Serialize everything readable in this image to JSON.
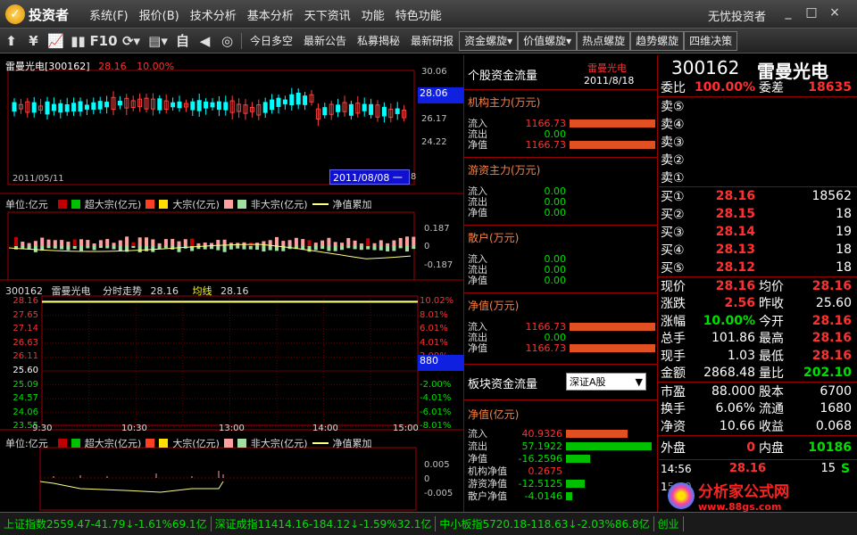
{
  "app": {
    "logo_text": "投资者",
    "brand": "无忧投资者"
  },
  "menu": [
    "系统(F)",
    "报价(B)",
    "技术分析",
    "基本分析",
    "天下资讯",
    "功能",
    "特色功能"
  ],
  "window_controls": [
    "_",
    "□",
    "×"
  ],
  "toolbar": {
    "icons": [
      "⬆",
      "¥",
      "📈",
      "▮▮",
      "F10",
      "⟳▾",
      "▤▾",
      "自",
      "◀",
      "◎"
    ],
    "tabs": [
      "今日多空",
      "最新公告",
      "私募揭秘",
      "最新研报",
      "资金螺旋▾",
      "价值螺旋▾",
      "热点螺旋",
      "趋势螺旋",
      "四维决策"
    ]
  },
  "kline": {
    "stock_label": "雷曼光电[300162]",
    "price": "28.16",
    "pct": "10.00%",
    "yticks": [
      "30.06",
      "26.17",
      "24.22"
    ],
    "current_price_tag": "28.06",
    "start_date": "2011/05/11",
    "cursor_date": "2011/08/08 一",
    "right_tick": "8"
  },
  "flow_legend": {
    "unit": "单位:亿元",
    "items": [
      {
        "label": "超大宗(亿元)",
        "c1": "#c00000",
        "c2": "#00c000"
      },
      {
        "label": "大宗(亿元)",
        "c1": "#ff4020",
        "c2": "#ffe000"
      },
      {
        "label": "非大宗(亿元)",
        "c1": "#ffa0a0",
        "c2": "#a0e0a0"
      }
    ],
    "line_label": "净值累加",
    "line_color": "#ffff80"
  },
  "flow_top": {
    "yticks": [
      "0.187",
      "0",
      "-0.187"
    ]
  },
  "intraday": {
    "code": "300162",
    "name": "雷曼光电",
    "mode": "分时走势",
    "price": "28.16",
    "avg_label": "均线",
    "avg": "28.16",
    "left_ticks": [
      "28.16",
      "27.65",
      "27.14",
      "26.63",
      "26.11",
      "25.60",
      "25.09",
      "24.57",
      "24.06",
      "23.55"
    ],
    "right_ticks": [
      "10.02%",
      "8.01%",
      "6.01%",
      "4.01%",
      "2.00%",
      "880",
      "-2.00%",
      "-4.01%",
      "-6.01%",
      "-8.01%"
    ],
    "times": [
      "9:30",
      "10:30",
      "13:00",
      "14:00",
      "15:00"
    ]
  },
  "flow_bottom": {
    "yticks": [
      "0.005",
      "0",
      "-0.005"
    ]
  },
  "midpanel": {
    "title": "个股资金流量",
    "stock_name": "雷曼光电",
    "date": "2011/8/18",
    "sections": [
      {
        "title": "机构主力(万元)",
        "rows": [
          {
            "k": "流入",
            "v": "1166.73",
            "color": "#ff3030",
            "bar": 1.0,
            "barcolor": "#e05020"
          },
          {
            "k": "流出",
            "v": "0.00",
            "color": "#00e000",
            "bar": 0,
            "barcolor": "#00c000"
          },
          {
            "k": "净值",
            "v": "1166.73",
            "color": "#ff3030",
            "bar": 1.0,
            "barcolor": "#e05020"
          }
        ]
      },
      {
        "title": "游资主力(万元)",
        "rows": [
          {
            "k": "流入",
            "v": "0.00",
            "color": "#00e000",
            "bar": 0,
            "barcolor": "#e05020"
          },
          {
            "k": "流出",
            "v": "0.00",
            "color": "#00e000",
            "bar": 0,
            "barcolor": "#00c000"
          },
          {
            "k": "净值",
            "v": "0.00",
            "color": "#00e000",
            "bar": 0,
            "barcolor": "#e05020"
          }
        ]
      },
      {
        "title": "散户(万元)",
        "rows": [
          {
            "k": "流入",
            "v": "0.00",
            "color": "#00e000",
            "bar": 0,
            "barcolor": "#e05020"
          },
          {
            "k": "流出",
            "v": "0.00",
            "color": "#00e000",
            "bar": 0,
            "barcolor": "#00c000"
          },
          {
            "k": "净值",
            "v": "0.00",
            "color": "#00e000",
            "bar": 0,
            "barcolor": "#e05020"
          }
        ]
      },
      {
        "title": "净值(万元)",
        "rows": [
          {
            "k": "流入",
            "v": "1166.73",
            "color": "#ff3030",
            "bar": 1.0,
            "barcolor": "#e05020"
          },
          {
            "k": "流出",
            "v": "0.00",
            "color": "#00e000",
            "bar": 0,
            "barcolor": "#00c000"
          },
          {
            "k": "净值",
            "v": "1166.73",
            "color": "#ff3030",
            "bar": 1.0,
            "barcolor": "#e05020"
          }
        ]
      }
    ],
    "sector_title": "板块资金流量",
    "sector_select": "深证A股",
    "sector_sub": "净值(亿元)",
    "sector_rows": [
      {
        "k": "流入",
        "v": "40.9326",
        "color": "#ff3030",
        "bar": 0.72,
        "barcolor": "#e05020"
      },
      {
        "k": "流出",
        "v": "57.1922",
        "color": "#00e000",
        "bar": 1.0,
        "barcolor": "#00c000"
      },
      {
        "k": "净值",
        "v": "-16.2596",
        "color": "#00e000",
        "bar": 0.28,
        "barcolor": "#00c000"
      },
      {
        "k": "机构净值",
        "v": "0.2675",
        "color": "#ff3030",
        "bar": 0.0,
        "barcolor": "#e05020"
      },
      {
        "k": "游资净值",
        "v": "-12.5125",
        "color": "#00e000",
        "bar": 0.22,
        "barcolor": "#00c000"
      },
      {
        "k": "散户净值",
        "v": "-4.0146",
        "color": "#00e000",
        "bar": 0.07,
        "barcolor": "#00c000"
      }
    ]
  },
  "quote": {
    "code": "300162",
    "name": "雷曼光电",
    "weibi_label": "委比",
    "weibi": "100.00%",
    "weicha_label": "委差",
    "weicha": "18635",
    "sells": [
      {
        "k": "卖⑤",
        "p": "",
        "v": ""
      },
      {
        "k": "卖④",
        "p": "",
        "v": ""
      },
      {
        "k": "卖③",
        "p": "",
        "v": ""
      },
      {
        "k": "卖②",
        "p": "",
        "v": ""
      },
      {
        "k": "卖①",
        "p": "",
        "v": ""
      }
    ],
    "buys": [
      {
        "k": "买①",
        "p": "28.16",
        "v": "18562"
      },
      {
        "k": "买②",
        "p": "28.15",
        "v": "18"
      },
      {
        "k": "买③",
        "p": "28.14",
        "v": "19"
      },
      {
        "k": "买④",
        "p": "28.13",
        "v": "18"
      },
      {
        "k": "买⑤",
        "p": "28.12",
        "v": "18"
      }
    ],
    "stats": [
      {
        "k": "现价",
        "v": "28.16",
        "vc": "#ff3030",
        "k2": "均价",
        "v2": "28.16",
        "v2c": "#ff3030"
      },
      {
        "k": "涨跌",
        "v": "2.56",
        "vc": "#ff3030",
        "k2": "昨收",
        "v2": "25.60",
        "v2c": "#ffffff"
      },
      {
        "k": "涨幅",
        "v": "10.00%",
        "vc": "#00e000",
        "k2": "今开",
        "v2": "28.16",
        "v2c": "#ff3030"
      },
      {
        "k": "总手",
        "v": "101.86",
        "vc": "#ffffff",
        "k2": "最高",
        "v2": "28.16",
        "v2c": "#ff3030"
      },
      {
        "k": "现手",
        "v": "1.03",
        "vc": "#ffffff",
        "k2": "最低",
        "v2": "28.16",
        "v2c": "#ff3030"
      },
      {
        "k": "金额",
        "v": "2868.48",
        "vc": "#ffffff",
        "k2": "量比",
        "v2": "202.10",
        "v2c": "#00e000"
      }
    ],
    "stats2": [
      {
        "k": "市盈",
        "v": "88.000",
        "vc": "#ffffff",
        "k2": "股本",
        "v2": "6700",
        "v2c": "#ffffff"
      },
      {
        "k": "换手",
        "v": "6.06%",
        "vc": "#ffffff",
        "k2": "流通",
        "v2": "1680",
        "v2c": "#ffffff"
      },
      {
        "k": "净资",
        "v": "10.66",
        "vc": "#ffffff",
        "k2": "收益",
        "v2": "0.068",
        "v2c": "#ffffff"
      }
    ],
    "waipan_label": "外盘",
    "waipan": "0",
    "neipan_label": "内盘",
    "neipan": "10186",
    "ticks": [
      {
        "t": "14:56",
        "p": "28.16",
        "v": "15",
        "s": "S"
      },
      {
        "t": "15:00",
        "p": "",
        "v": "",
        "s": ""
      }
    ]
  },
  "status": [
    {
      "name": "上证指数",
      "val": "2559.47",
      "chg": "-41.79↓",
      "pct": "-1.61%",
      "amt": "69.1亿"
    },
    {
      "name": "深证成指",
      "val": "11414.16",
      "chg": "-184.12↓",
      "pct": "-1.59%",
      "amt": "32.1亿"
    },
    {
      "name": "中小板指",
      "val": "5720.18",
      "chg": "-118.63↓",
      "pct": "-2.03%",
      "amt": "86.8亿"
    },
    {
      "name": "创业",
      "val": "",
      "chg": "",
      "pct": "",
      "amt": ""
    }
  ],
  "watermark": {
    "line1": "分析家公式网",
    "line2": "www.88gs.com"
  }
}
